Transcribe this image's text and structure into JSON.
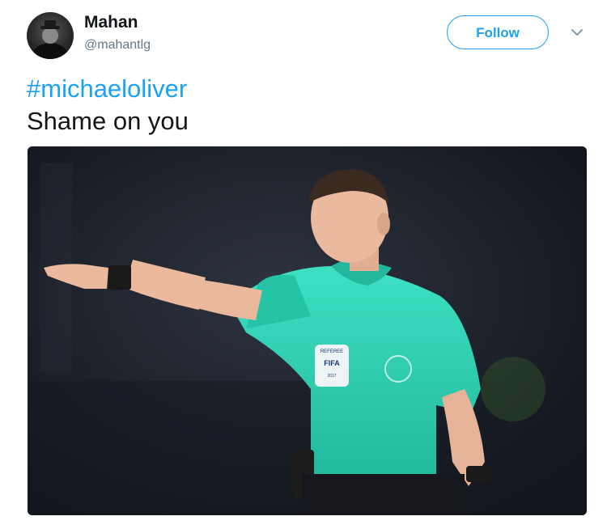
{
  "tweet": {
    "author": {
      "name": "Mahan",
      "handle": "@mahantlg",
      "avatar_icon": "user-avatar"
    },
    "follow_label": "Follow",
    "menu_icon": "chevron-down-icon",
    "hashtag": "#michaeloliver",
    "text": "Shame on you",
    "media": {
      "badge_lines": [
        "REFEREE",
        "FIFA",
        "2017"
      ]
    }
  },
  "colors": {
    "accent": "#1da1f2",
    "text": "#14171a",
    "secondary_text": "#657786",
    "shirt": "#2fd3b6"
  }
}
